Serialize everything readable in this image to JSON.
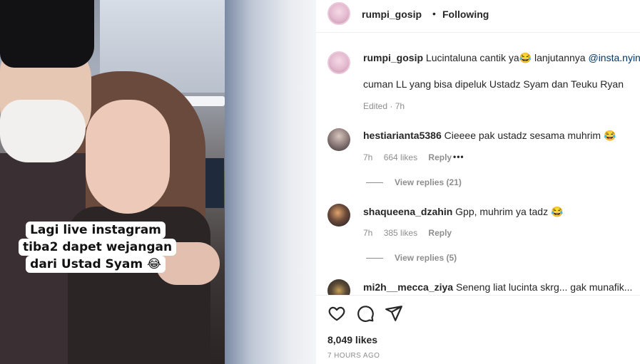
{
  "media": {
    "caption": "Lagi live instagram tiba2 dapet wejangan dari Ustad Syam 😂"
  },
  "header": {
    "username": "rumpi_gosip",
    "separator": "•",
    "follow_status": "Following"
  },
  "post_caption": {
    "username": "rumpi_gosip",
    "text": "Lucintaluna cantik ya😂  lanjutannya ",
    "mention": "@insta.nyinyir",
    "line2": "cuman LL yang bisa dipeluk Ustadz Syam dan Teuku Ryan",
    "meta": "Edited · 7h"
  },
  "comments": [
    {
      "username": "hestiarianta5386",
      "text": "Cieeee pak ustadz sesama muhrim 😂",
      "time": "7h",
      "likes": "664 likes",
      "reply": "Reply",
      "more": "•••",
      "view_replies": "View replies (21)"
    },
    {
      "username": "shaqueena_dzahin",
      "text": "Gpp, muhrim ya tadz 😂",
      "time": "7h",
      "likes": "385 likes",
      "reply": "Reply",
      "view_replies": "View replies (5)"
    },
    {
      "username": "mi2h__mecca_ziya",
      "text": "Seneng liat lucinta skrg... gak munafik..."
    }
  ],
  "footer": {
    "likes": "8,049 likes",
    "time": "7 HOURS AGO",
    "icons": [
      "heart-icon",
      "comment-icon",
      "share-icon"
    ]
  },
  "colors": {
    "text": "#262626",
    "muted": "#8e8e8e",
    "mention": "#00376b",
    "border": "#efefef"
  }
}
